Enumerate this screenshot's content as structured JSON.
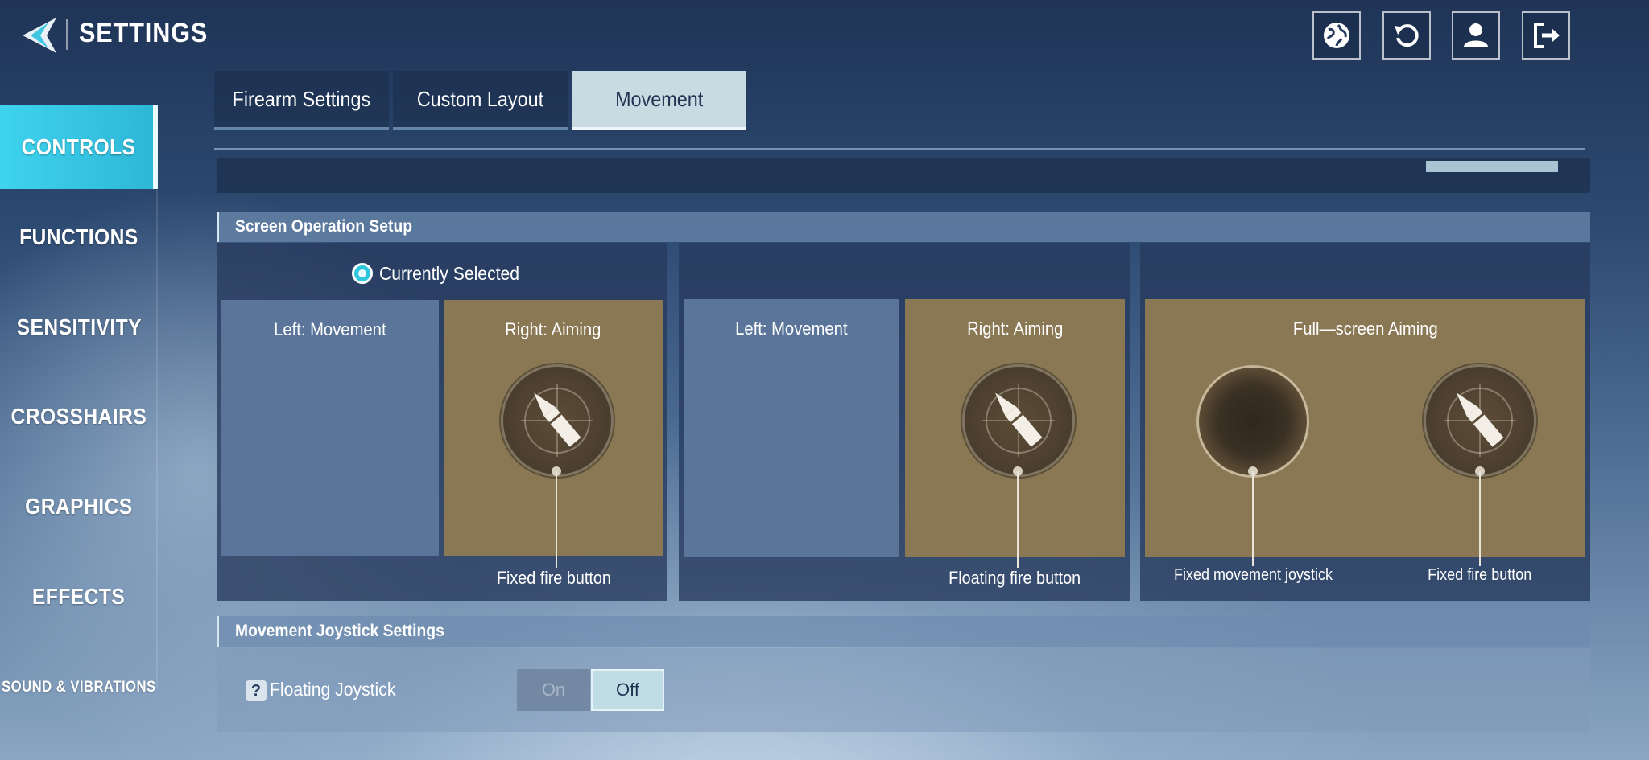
{
  "header": {
    "title": "SETTINGS"
  },
  "top_icons": [
    "globe-icon",
    "refresh-icon",
    "profile-icon",
    "exit-icon"
  ],
  "sidebar": {
    "items": [
      {
        "label": "CONTROLS",
        "active": true
      },
      {
        "label": "FUNCTIONS",
        "active": false
      },
      {
        "label": "SENSITIVITY",
        "active": false
      },
      {
        "label": "CROSSHAIRS",
        "active": false
      },
      {
        "label": "GRAPHICS",
        "active": false
      },
      {
        "label": "EFFECTS",
        "active": false
      },
      {
        "label": "SOUND & VIBRATIONS",
        "active": false
      }
    ]
  },
  "tabs": [
    {
      "label": "Firearm Settings",
      "active": false
    },
    {
      "label": "Custom Layout",
      "active": false
    },
    {
      "label": "Movement",
      "active": true
    }
  ],
  "screen_operation": {
    "title": "Screen Operation Setup",
    "selected_label": "Currently Selected",
    "options": [
      {
        "left": "Left: Movement",
        "right": "Right: Aiming",
        "caption": "Fixed fire button",
        "selected": true
      },
      {
        "left": "Left: Movement",
        "right": "Right: Aiming",
        "caption": "Floating fire button",
        "selected": false
      },
      {
        "full": "Full—screen Aiming",
        "caption_left": "Fixed movement joystick",
        "caption_right": "Fixed fire button",
        "selected": false
      }
    ]
  },
  "movement_joystick": {
    "title": "Movement Joystick Settings",
    "floating_label": "Floating Joystick",
    "help_icon": "?",
    "on_label": "On",
    "off_label": "Off",
    "value": "Off"
  },
  "colors": {
    "accent": "#2fc6e0",
    "zone_blue": "#5a7599",
    "zone_gold": "#8a7855"
  }
}
